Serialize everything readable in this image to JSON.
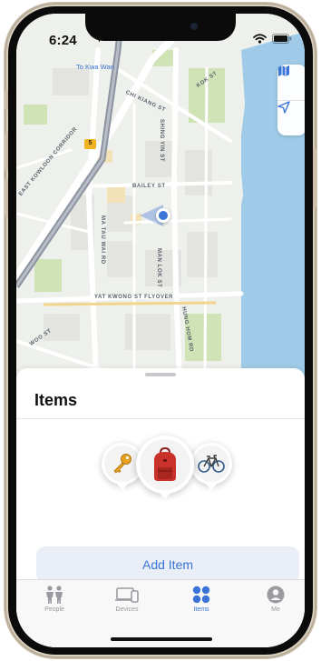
{
  "status_bar": {
    "time": "6:24"
  },
  "map": {
    "place_label": "To Kwa Wan",
    "route_shield": "5",
    "street_labels": [
      "EAST KOWLOON CORRIDOR",
      "MA TAU WAI RD",
      "YAT KWONG ST FLYOVER",
      "BAILEY ST",
      "SHING YIN ST",
      "MAN LOK ST",
      "HUNG HOM RD",
      "WOO ST",
      "CHI KIANG ST",
      "KOK ST"
    ]
  },
  "sheet": {
    "title": "Items",
    "items": [
      {
        "icon": "key-icon"
      },
      {
        "icon": "backpack-icon"
      },
      {
        "icon": "bicycle-icon"
      }
    ],
    "add_button_label": "Add Item"
  },
  "tabbar": {
    "tabs": [
      {
        "label": "People",
        "icon": "people-icon",
        "active": false
      },
      {
        "label": "Devices",
        "icon": "devices-icon",
        "active": false
      },
      {
        "label": "Items",
        "icon": "items-icon",
        "active": true
      },
      {
        "label": "Me",
        "icon": "me-icon",
        "active": false
      }
    ]
  },
  "colors": {
    "accent": "#3a74d7",
    "water": "#9fcbe8",
    "park": "#cfe3b6",
    "backpack": "#c8322b"
  }
}
